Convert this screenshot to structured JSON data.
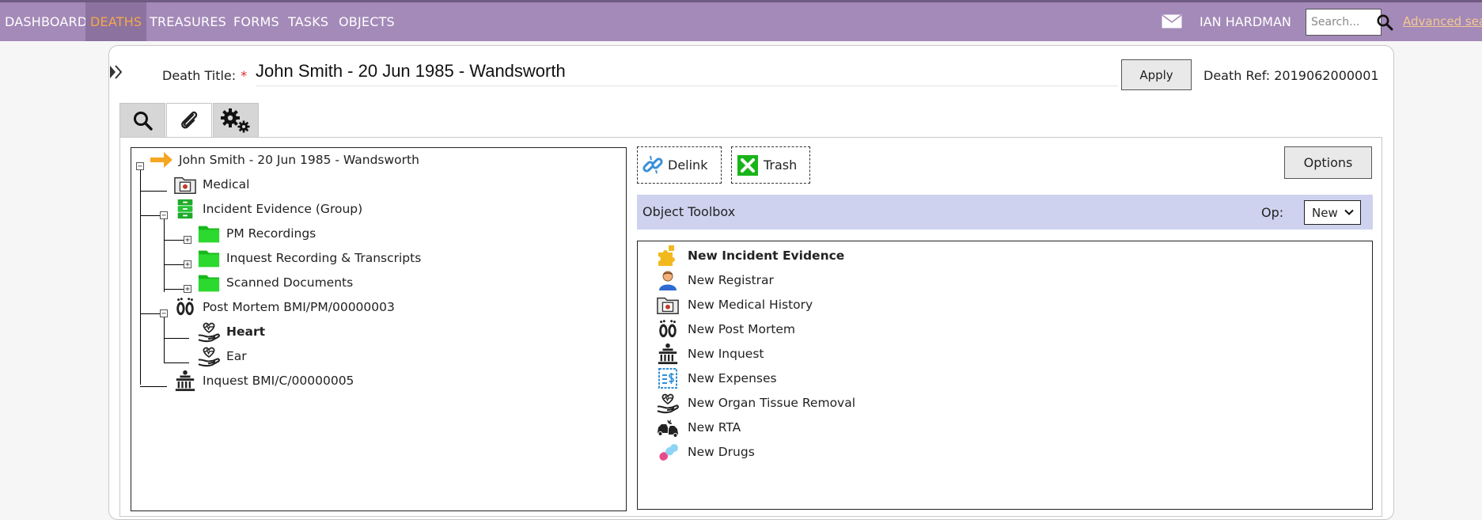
{
  "nav": {
    "items": [
      {
        "label": "DASHBOARD"
      },
      {
        "label": "DEATHS"
      },
      {
        "label": "TREASURES"
      },
      {
        "label": "FORMS"
      },
      {
        "label": "TASKS"
      },
      {
        "label": "OBJECTS"
      }
    ],
    "active": "DEATHS",
    "user": "IAN HARDMAN",
    "search_placeholder": "Search...",
    "advanced_search": "Advanced search",
    "colors": {
      "bar": "#a48ab8",
      "active_bg": "#8b729f",
      "active_text": "#f5a74b"
    }
  },
  "header": {
    "death_title_label": "Death Title:",
    "required_marker": "*",
    "death_title_value": "John Smith - 20 Jun 1985 - Wandsworth",
    "apply_label": "Apply",
    "death_ref": "Death Ref: 2019062000001"
  },
  "tabs": [
    {
      "icon": "search-icon"
    },
    {
      "icon": "paperclip-icon"
    },
    {
      "icon": "gears-icon"
    }
  ],
  "tree": {
    "root": "John Smith - 20 Jun 1985 - Wandsworth",
    "nodes": [
      {
        "label": "Medical",
        "icon": "medical-folder-icon"
      },
      {
        "label": "Incident Evidence (Group)",
        "icon": "evidence-group-icon"
      },
      {
        "label": "PM Recordings",
        "icon": "green-folder-icon"
      },
      {
        "label": "Inquest Recording & Transcripts",
        "icon": "green-folder-icon"
      },
      {
        "label": "Scanned Documents",
        "icon": "green-folder-icon"
      },
      {
        "label": "Post Mortem BMI/PM/00000003",
        "icon": "footprints-icon"
      },
      {
        "label": "Heart",
        "icon": "organ-hand-icon"
      },
      {
        "label": "Ear",
        "icon": "organ-hand-icon"
      },
      {
        "label": "Inquest BMI/C/00000005",
        "icon": "courthouse-icon"
      }
    ]
  },
  "actions": {
    "delink": "Delink",
    "trash": "Trash",
    "options": "Options"
  },
  "toolbox": {
    "title": "Object Toolbox",
    "op_label": "Op:",
    "op_value": "New",
    "items": [
      {
        "label": "New Incident Evidence",
        "icon": "puzzle-icon"
      },
      {
        "label": "New Registrar",
        "icon": "person-icon"
      },
      {
        "label": "New Medical History",
        "icon": "medical-folder-icon"
      },
      {
        "label": "New Post Mortem",
        "icon": "footprints-icon"
      },
      {
        "label": "New Inquest",
        "icon": "courthouse-icon"
      },
      {
        "label": "New Expenses",
        "icon": "receipt-icon"
      },
      {
        "label": "New Organ Tissue Removal",
        "icon": "organ-hand-icon"
      },
      {
        "label": "New RTA",
        "icon": "car-crash-icon"
      },
      {
        "label": "New Drugs",
        "icon": "pills-icon"
      }
    ]
  }
}
